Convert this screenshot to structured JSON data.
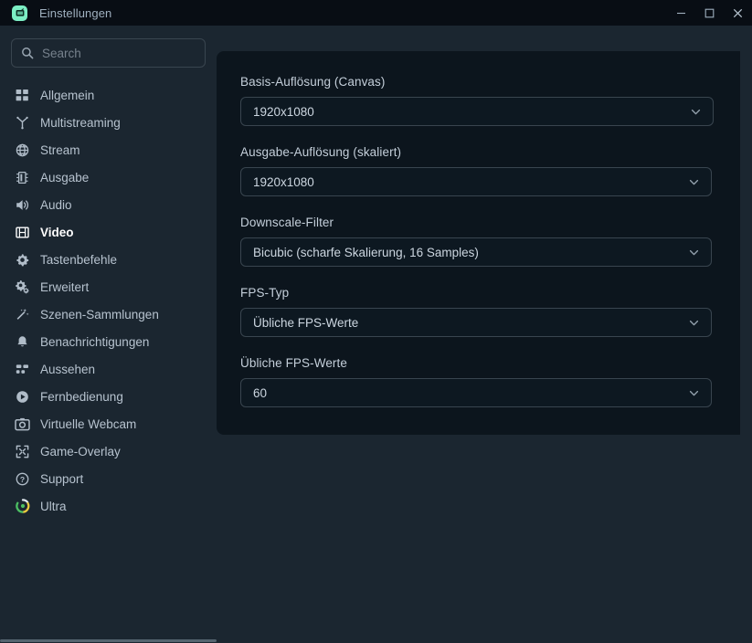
{
  "window": {
    "title": "Einstellungen",
    "app_icon": "obs-studio-icon",
    "controls": {
      "minimize": "minimize-icon",
      "maximize": "maximize-icon",
      "close": "close-icon"
    }
  },
  "sidebar": {
    "search": {
      "icon": "search-icon",
      "value": "",
      "placeholder": "Search"
    },
    "items": [
      {
        "label": "Allgemein",
        "icon": "grid-icon",
        "active": false
      },
      {
        "label": "Multistreaming",
        "icon": "branch-icon",
        "active": false
      },
      {
        "label": "Stream",
        "icon": "globe-icon",
        "active": false
      },
      {
        "label": "Ausgabe",
        "icon": "chip-icon",
        "active": false
      },
      {
        "label": "Audio",
        "icon": "speaker-icon",
        "active": false
      },
      {
        "label": "Video",
        "icon": "film-icon",
        "active": true
      },
      {
        "label": "Tastenbefehle",
        "icon": "gear-icon",
        "active": false
      },
      {
        "label": "Erweitert",
        "icon": "gears-icon",
        "active": false
      },
      {
        "label": "Szenen-Sammlungen",
        "icon": "magic-wand-icon",
        "active": false
      },
      {
        "label": "Benachrichtigungen",
        "icon": "bell-icon",
        "active": false
      },
      {
        "label": "Aussehen",
        "icon": "layout-icon",
        "active": false
      },
      {
        "label": "Fernbedienung",
        "icon": "play-circle-icon",
        "active": false
      },
      {
        "label": "Virtuelle Webcam",
        "icon": "camera-icon",
        "active": false
      },
      {
        "label": "Game-Overlay",
        "icon": "expand-icon",
        "active": false
      },
      {
        "label": "Support",
        "icon": "help-circle-icon",
        "active": false
      },
      {
        "label": "Ultra",
        "icon": "ultra-logo-icon",
        "active": false
      }
    ]
  },
  "main": {
    "fields": [
      {
        "label": "Basis-Auflösung (Canvas)",
        "value": "1920x1080",
        "chevron": "chevron-down-icon"
      },
      {
        "label": "Ausgabe-Auflösung (skaliert)",
        "value": "1920x1080",
        "chevron": "chevron-down-icon"
      },
      {
        "label": "Downscale-Filter",
        "value": "Bicubic (scharfe Skalierung, 16 Samples)",
        "chevron": "chevron-down-icon"
      },
      {
        "label": "FPS-Typ",
        "value": "Übliche FPS-Werte",
        "chevron": "chevron-down-icon"
      },
      {
        "label": "Übliche FPS-Werte",
        "value": "60",
        "chevron": "chevron-down-icon"
      }
    ]
  },
  "colors": {
    "titlebar_bg": "#080d14",
    "body_bg": "#1b2630",
    "card_bg": "#0c151d",
    "accent": "#7ceec4",
    "border": "#39454f",
    "text": "#c8d2dc",
    "text_muted": "#77828d",
    "active_text": "#ffffff"
  }
}
